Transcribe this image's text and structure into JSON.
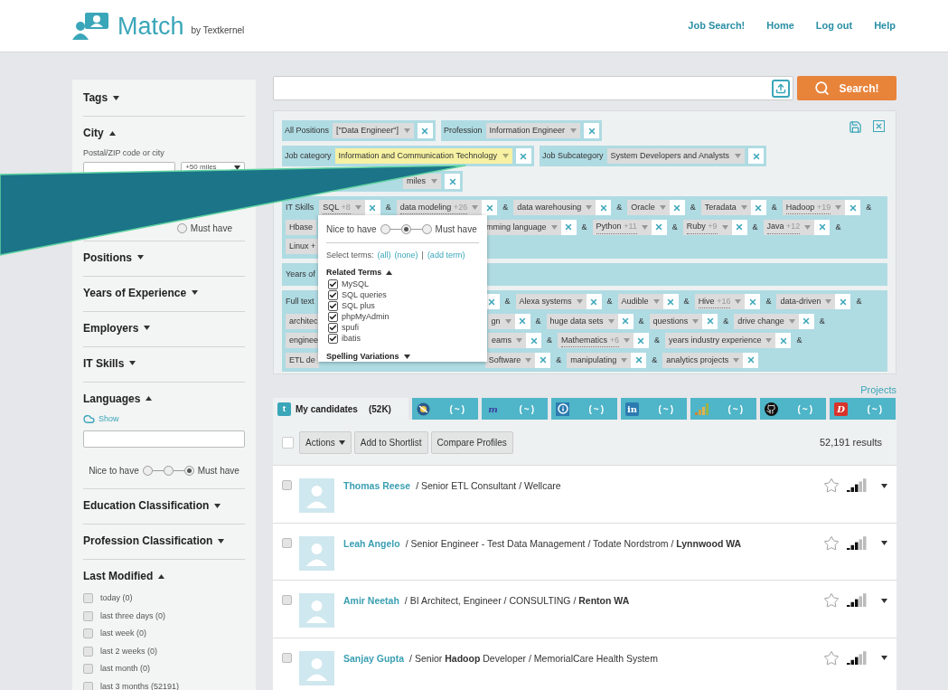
{
  "header": {
    "brand": "Match",
    "by": "by Textkernel",
    "nav": [
      "Job Search!",
      "Home",
      "Log out",
      "Help"
    ]
  },
  "sidebar": {
    "sections": [
      {
        "title": "Tags",
        "expanded": false,
        "kind": "plain"
      },
      {
        "title": "City",
        "expanded": true,
        "kind": "city",
        "field_label": "Postal/ZIP code or city",
        "select": "+50 miles",
        "slider": {
          "right": "Must have",
          "options": [
            {
              "selected": false
            }
          ]
        }
      },
      {
        "title": "Positions",
        "expanded": false,
        "kind": "plain"
      },
      {
        "title": "Years of Experience",
        "expanded": false,
        "kind": "plain"
      },
      {
        "title": "Employers",
        "expanded": false,
        "kind": "plain"
      },
      {
        "title": "IT Skills",
        "expanded": false,
        "kind": "plain"
      },
      {
        "title": "Languages",
        "expanded": true,
        "kind": "languages",
        "show": "Show",
        "slider": {
          "left": "Nice to have",
          "right": "Must have",
          "options": [
            {
              "selected": false
            },
            {
              "selected": false
            },
            {
              "selected": true
            }
          ]
        }
      },
      {
        "title": "Education Classification",
        "expanded": false,
        "kind": "plain"
      },
      {
        "title": "Profession Classification",
        "expanded": false,
        "kind": "plain"
      },
      {
        "title": "Last Modified",
        "expanded": true,
        "kind": "checklist",
        "items": [
          {
            "label": "today (0)",
            "checked": false
          },
          {
            "label": "last three days (0)",
            "checked": false
          },
          {
            "label": "last week (0)",
            "checked": false
          },
          {
            "label": "last 2 weeks (0)",
            "checked": false
          },
          {
            "label": "last month (0)",
            "checked": false
          },
          {
            "label": "last 3 months (52191)",
            "checked": false
          }
        ]
      }
    ]
  },
  "search": {
    "button": "Search!"
  },
  "filters": {
    "rows": [
      [
        {
          "label": "All Positions",
          "value": "[\"Data Engineer\"]",
          "highlighted": false
        },
        {
          "label": "Profession",
          "value": "Information Engineer",
          "highlighted": false
        }
      ],
      [
        {
          "label": "Job category",
          "value": "Information and Communication Technology",
          "highlighted": true
        },
        {
          "label": "Job Subcategory",
          "value": "System Developers and Analysts",
          "highlighted": false
        }
      ],
      [
        {
          "value": "miles",
          "highlighted": false
        }
      ]
    ],
    "blocks": [
      {
        "label": "IT Skills",
        "lines": [
          [
            {
              "kind": "chip",
              "text": "SQL",
              "extra": "+8",
              "joiner": "&"
            },
            {
              "kind": "chip",
              "text": "data modeling",
              "extra": "+26",
              "joiner": "&"
            },
            {
              "kind": "chip",
              "text": "data warehousing",
              "joiner": "&"
            },
            {
              "kind": "chip",
              "text": "Oracle",
              "joiner": "&"
            },
            {
              "kind": "chip",
              "text": "Teradata",
              "joiner": "&"
            },
            {
              "kind": "chip",
              "text": "Hadoop",
              "extra": "+19",
              "joiner": "&"
            }
          ],
          [
            {
              "kind": "cut",
              "text": "Hbase"
            },
            {
              "kind": "chip",
              "text": "mming language",
              "joiner": "&"
            },
            {
              "kind": "chip",
              "text": "Python",
              "extra": "+11",
              "joiner": "&"
            },
            {
              "kind": "chip",
              "text": "Ruby",
              "extra": "+9",
              "joiner": "&"
            },
            {
              "kind": "chip",
              "text": "Java",
              "extra": "+12",
              "joiner": "&"
            }
          ],
          [
            {
              "kind": "cut",
              "text": "Linux +"
            }
          ]
        ]
      },
      {
        "label": "Years of"
      },
      {
        "label": "Full text",
        "lines": [
          [
            {
              "kind": "xonly",
              "joiner": "&"
            },
            {
              "kind": "chip",
              "text": "Alexa systems",
              "joiner": "&"
            },
            {
              "kind": "chip",
              "text": "Audible",
              "joiner": "&"
            },
            {
              "kind": "chip",
              "text": "Hive",
              "extra": "+16",
              "joiner": "&"
            },
            {
              "kind": "chip",
              "text": "data-driven",
              "joiner": "&"
            }
          ],
          [
            {
              "kind": "cut",
              "text": "architec"
            },
            {
              "kind": "chip",
              "text": "gn",
              "joiner": "&"
            },
            {
              "kind": "chip",
              "text": "huge data sets",
              "joiner": "&"
            },
            {
              "kind": "chip",
              "text": "questions",
              "joiner": "&"
            },
            {
              "kind": "chip",
              "text": "drive change",
              "joiner": "&"
            }
          ],
          [
            {
              "kind": "cut",
              "text": "enginee"
            },
            {
              "kind": "chip",
              "text": "eams",
              "joiner": "&"
            },
            {
              "kind": "chip",
              "text": "Mathematics",
              "extra": "+6",
              "joiner": "&"
            },
            {
              "kind": "chip",
              "text": "years industry experience",
              "joiner": "&"
            }
          ],
          [
            {
              "kind": "cut",
              "text": "ETL de"
            },
            {
              "kind": "chip",
              "text": "Software",
              "joiner": "&"
            },
            {
              "kind": "chip",
              "text": "manipulating",
              "joiner": "&"
            },
            {
              "kind": "chip",
              "text": "analytics projects"
            }
          ]
        ]
      }
    ]
  },
  "term_popup": {
    "slider": {
      "left": "Nice to have",
      "right": "Must have",
      "options": [
        {
          "selected": false
        },
        {
          "selected": true
        },
        {
          "selected": false
        }
      ]
    },
    "select_label": "Select terms:",
    "links": [
      "(all)",
      "(none)",
      "(add term)"
    ],
    "divider": "|",
    "related_title": "Related Terms",
    "related_expanded": true,
    "terms": [
      {
        "label": "MySQL",
        "checked": true
      },
      {
        "label": "SQL queries",
        "checked": true
      },
      {
        "label": "SQL plus",
        "checked": true
      },
      {
        "label": "phpMyAdmin",
        "checked": true
      },
      {
        "label": "spufi",
        "checked": true
      },
      {
        "label": "ibatis",
        "checked": true
      }
    ],
    "spelling_title": "Spelling Variations",
    "spelling_expanded": false
  },
  "projects_link": "Projects",
  "tabs": [
    {
      "badge": "t",
      "label": "My candidates",
      "count": "(52K)",
      "selected": true
    },
    {
      "count": "(~)",
      "selected": false
    },
    {
      "badge": "m",
      "count": "(~)",
      "selected": false
    },
    {
      "count": "(~)",
      "selected": false
    },
    {
      "badge": "in",
      "count": "(~)",
      "selected": false
    },
    {
      "count": "(~)",
      "selected": false
    },
    {
      "count": "(~)",
      "selected": false
    },
    {
      "badge": "D",
      "count": "(~)",
      "selected": false
    }
  ],
  "toolbar": {
    "select_all": false,
    "buttons": [
      "Actions",
      "Add to Shortlist",
      "Compare Profiles"
    ],
    "results": "52,191 results"
  },
  "candidates": [
    {
      "name": "Thomas Reese",
      "details": "/ Senior ETL Consultant / Wellcare",
      "checked": false,
      "starred": false
    },
    {
      "name": "Leah Angelo",
      "details": "/ Senior Engineer - Test Data Management / Todate Nordstrom / **Lynnwood WA**",
      "checked": false,
      "starred": false
    },
    {
      "name": "Amir Neetah",
      "details": "/ BI Architect, Engineer / CONSULTING / **Renton WA**",
      "checked": false,
      "starred": false
    },
    {
      "name": "Sanjay Gupta",
      "details": "/ Senior **Hadoop** Developer / MemorialCare Health System",
      "checked": false,
      "starred": false
    }
  ]
}
